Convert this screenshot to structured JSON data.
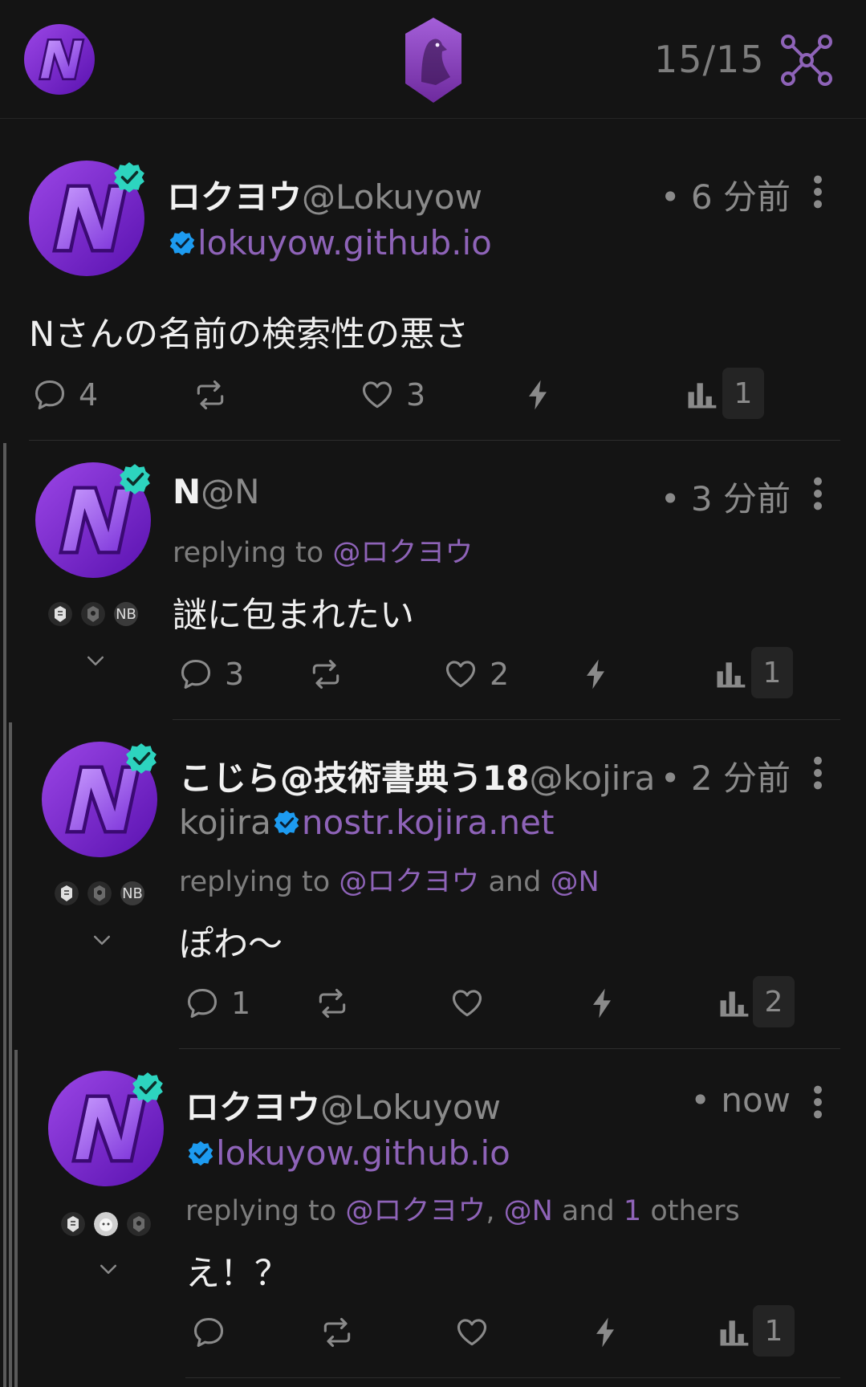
{
  "header": {
    "relay_count": "15/15",
    "colors": {
      "accent": "#8e63b8",
      "verified": "#2dd4bf",
      "nip05": "#1d9bf0"
    }
  },
  "posts": [
    {
      "display_name": "ロクヨウ",
      "handle": "@Lokuyow",
      "nip05_domain": "lokuyow.github.io",
      "time": "• 6 分前",
      "content": "Nさんの名前の検索性の悪さ",
      "reply_count": "4",
      "like_count": "3",
      "views": "1"
    },
    {
      "display_name": "N",
      "handle": "@N",
      "time": "• 3 分前",
      "replying_prefix": "replying to ",
      "replying_mention": "@ロクヨウ",
      "content": "謎に包まれたい",
      "reactor_label": "NB",
      "reply_count": "3",
      "like_count": "2",
      "views": "1"
    },
    {
      "display_name": "こじら@技術書典う18",
      "handle": "@kojira",
      "nip05_user": "kojira",
      "nip05_domain": "nostr.kojira.net",
      "time": "• 2 分前",
      "replying_prefix": "replying to ",
      "replying_mention1": "@ロクヨウ",
      "replying_and": " and ",
      "replying_mention2": "@N",
      "content": "ぽわ〜",
      "reactor_label": "NB",
      "reply_count": "1",
      "views": "2"
    },
    {
      "display_name": "ロクヨウ",
      "handle": "@Lokuyow",
      "nip05_domain": "lokuyow.github.io",
      "time": "• now",
      "replying_prefix": "replying to ",
      "replying_mention1": "@ロクヨウ",
      "replying_sep": ", ",
      "replying_mention2": "@N",
      "replying_and": " and ",
      "replying_others_count": "1",
      "replying_others": " others",
      "content": "え！？",
      "views": "1"
    }
  ]
}
